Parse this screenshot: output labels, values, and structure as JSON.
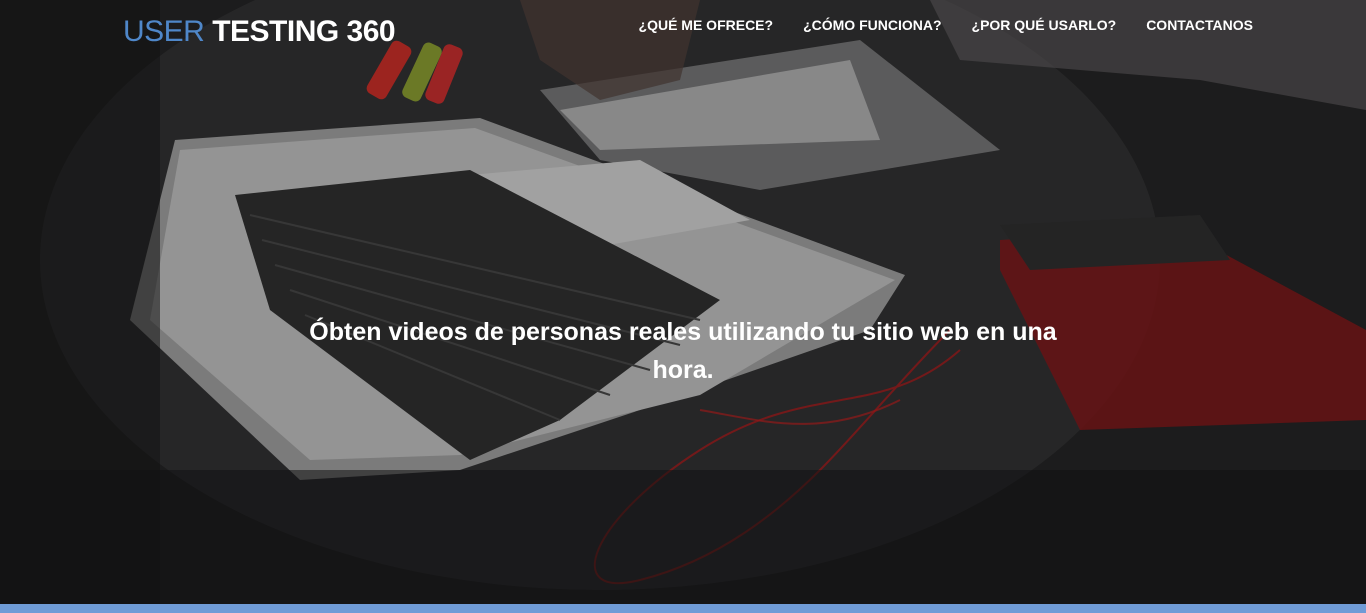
{
  "header": {
    "logo_part1": "USER",
    "logo_part2": "TESTING 360"
  },
  "nav": {
    "items": [
      {
        "label": "¿QUÉ ME OFRECE?"
      },
      {
        "label": "¿CÓMO FUNCIONA?"
      },
      {
        "label": "¿POR QUÉ USARLO?"
      },
      {
        "label": "CONTACTANOS"
      }
    ]
  },
  "hero": {
    "headline": "Óbten videos de personas reales utilizando tu sitio web en una hora."
  },
  "colors": {
    "logo_accent": "#4f87c9",
    "bottom_bar": "#6f9bd6",
    "text": "#ffffff"
  }
}
